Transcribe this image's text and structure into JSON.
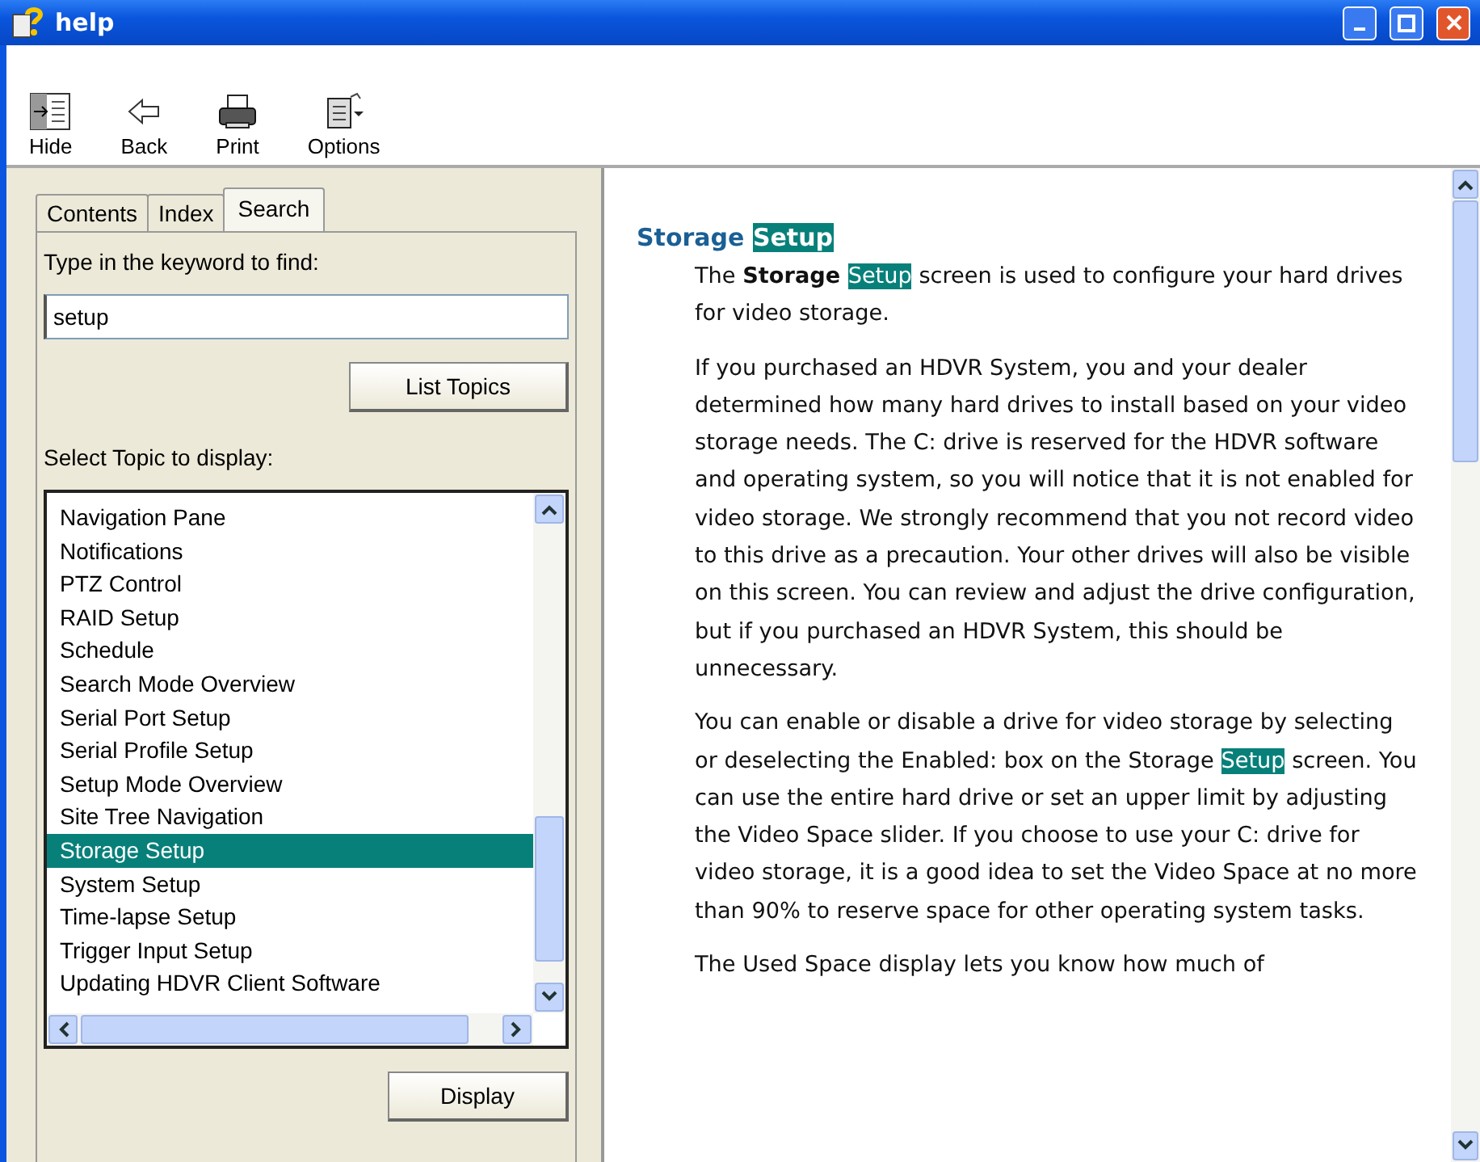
{
  "window": {
    "title": "help"
  },
  "toolbar": [
    {
      "label": "Hide",
      "kind": "hide"
    },
    {
      "label": "Back",
      "kind": "back"
    },
    {
      "label": "Print",
      "kind": "print"
    },
    {
      "label": "Options",
      "kind": "options"
    }
  ],
  "tabs": [
    {
      "label": "Contents",
      "selected": false
    },
    {
      "label": "Index",
      "selected": false
    },
    {
      "label": "Search",
      "selected": true
    }
  ],
  "search": {
    "label": "Type in the keyword to find:",
    "value": "setup",
    "button": "List Topics"
  },
  "topics": {
    "label": "Select Topic to display:",
    "items": [
      {
        "label": "Navigation Pane",
        "selected": false
      },
      {
        "label": "Notifications",
        "selected": false
      },
      {
        "label": "PTZ Control",
        "selected": false
      },
      {
        "label": "RAID Setup",
        "selected": false
      },
      {
        "label": "Schedule",
        "selected": false
      },
      {
        "label": "Search Mode Overview",
        "selected": false
      },
      {
        "label": "Serial Port Setup",
        "selected": false
      },
      {
        "label": "Serial Profile Setup",
        "selected": false
      },
      {
        "label": "Setup Mode Overview",
        "selected": false
      },
      {
        "label": "Site Tree Navigation",
        "selected": false
      },
      {
        "label": "Storage Setup",
        "selected": true
      },
      {
        "label": "System Setup",
        "selected": false
      },
      {
        "label": "Time-lapse Setup",
        "selected": false
      },
      {
        "label": "Trigger Input Setup",
        "selected": false
      },
      {
        "label": "Updating HDVR Client Software",
        "selected": false
      }
    ],
    "button": "Display"
  },
  "article": {
    "heading": [
      {
        "text": "Storage ",
        "kind": "plain"
      },
      {
        "text": "Setup",
        "kind": "highlight"
      }
    ],
    "paragraphs": [
      [
        {
          "text": "The ",
          "kind": "plain"
        },
        {
          "text": "Storage ",
          "kind": "bold"
        },
        {
          "text": "Setup",
          "kind": "highlight"
        },
        {
          "text": " screen is used to configure your hard drives for video storage.",
          "kind": "plain"
        }
      ],
      [
        {
          "text": "If you purchased an HDVR System, you and your dealer determined how many hard drives to install based on your video storage needs. The C: drive is reserved for the HDVR software and operating system, so you will notice that it is not enabled for video storage. We strongly recommend that you not record video to this drive as a precaution. Your other drives will also be visible on this screen. You can review and adjust the drive configuration, but if you purchased an HDVR System, this should be unnecessary.",
          "kind": "plain"
        }
      ],
      [
        {
          "text": "You can enable or disable a drive for video storage by selecting or deselecting the Enabled: box on the Storage ",
          "kind": "plain"
        },
        {
          "text": "Setup",
          "kind": "highlight"
        },
        {
          "text": " screen. You can use the entire hard drive or set an upper limit by adjusting the Video Space slider. If you choose to use your C: drive for video storage, it is a good idea to set the Video Space at no more than 90% to reserve space for other operating system tasks.",
          "kind": "plain"
        }
      ],
      [
        {
          "text": "The Used Space display lets you know how much of",
          "kind": "plain"
        }
      ]
    ]
  }
}
